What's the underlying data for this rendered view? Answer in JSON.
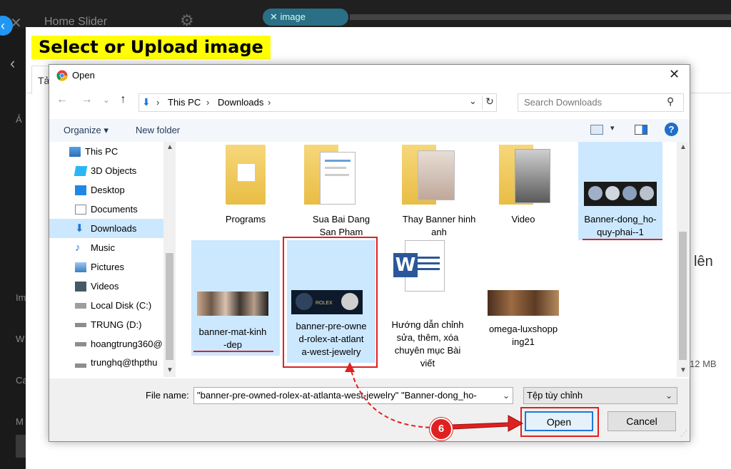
{
  "background": {
    "header_title": "Home Slider",
    "tag_label": "image",
    "modal_title": "Select or Upload image",
    "modal_tab": "Tả",
    "side_letters": [
      "Ả",
      "Im",
      "W",
      "Ca",
      "M"
    ],
    "right_text": "lên",
    "size_text": "12 MB"
  },
  "dialog": {
    "title": "Open",
    "path": [
      "This PC",
      "Downloads"
    ],
    "search_placeholder": "Search Downloads",
    "toolbar": {
      "organize": "Organize",
      "new_folder": "New folder"
    },
    "nav_items": [
      {
        "label": "This PC",
        "icon": "pc-icon"
      },
      {
        "label": "3D Objects",
        "icon": "3d-objects-icon"
      },
      {
        "label": "Desktop",
        "icon": "desktop-icon"
      },
      {
        "label": "Documents",
        "icon": "documents-icon"
      },
      {
        "label": "Downloads",
        "icon": "downloads-icon"
      },
      {
        "label": "Music",
        "icon": "music-icon"
      },
      {
        "label": "Pictures",
        "icon": "pictures-icon"
      },
      {
        "label": "Videos",
        "icon": "videos-icon"
      },
      {
        "label": "Local Disk (C:)",
        "icon": "disk-icon"
      },
      {
        "label": "TRUNG (D:)",
        "icon": "drive-icon"
      },
      {
        "label": "hoangtrung360@",
        "icon": "network-drive-icon"
      },
      {
        "label": "trunghq@thpthu",
        "icon": "network-drive-icon"
      }
    ],
    "files": [
      {
        "name": "Programs",
        "type": "folder"
      },
      {
        "name": "Sua Bai Dang San Pham",
        "type": "folder"
      },
      {
        "name": "Thay Banner hinh anh",
        "type": "folder"
      },
      {
        "name": "Video",
        "type": "folder"
      },
      {
        "name": "Banner-dong_ho-quy-phai--1",
        "type": "image",
        "selected": true
      },
      {
        "name": "banner-mat-kinh-dep",
        "type": "image",
        "selected": true
      },
      {
        "name": "banner-pre-owned-rolex-at-atlanta-west-jewelry",
        "type": "image",
        "selected": true
      },
      {
        "name": "Hướng dẫn chỉnh sửa, thêm, xóa chuyên mục Bài viết",
        "type": "word"
      },
      {
        "name": "omega-luxshopping21",
        "type": "image"
      }
    ],
    "tile_lines": {
      "programs": [
        "Programs"
      ],
      "sua": [
        "Sua Bai Dang",
        "San Pham"
      ],
      "thay": [
        "Thay Banner hinh",
        "anh"
      ],
      "video": [
        "Video"
      ],
      "dongho": [
        "Banner-dong_ho-",
        "quy-phai--1"
      ],
      "matkinh": [
        "banner-mat-kinh",
        "-dep"
      ],
      "rolex": [
        "banner-pre-owne",
        "d-rolex-at-atlant",
        "a-west-jewelry"
      ],
      "huong": [
        "Hướng dẫn chỉnh",
        "sửa, thêm, xóa",
        "chuyên mục Bài",
        "viết"
      ],
      "omega": [
        "omega-luxshopp",
        "ing21"
      ]
    },
    "rolex_logo_text": "ROLEX",
    "filename_label": "File name:",
    "filename_value": "\"banner-pre-owned-rolex-at-atlanta-west-jewelry\" \"Banner-dong_ho-",
    "filetype_value": "Tệp tùy chỉnh",
    "open_button": "Open",
    "cancel_button": "Cancel"
  },
  "annotation": {
    "step_number": "6",
    "color": "#e02020"
  },
  "colors": {
    "selection": "#cce8ff",
    "highlight": "#ffff00",
    "accent": "#1e78d7"
  }
}
